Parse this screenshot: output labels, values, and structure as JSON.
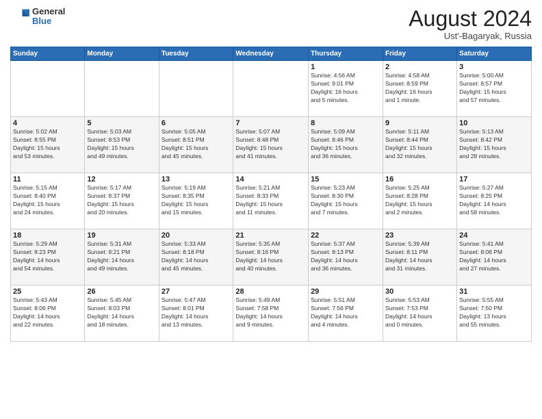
{
  "logo": {
    "general": "General",
    "blue": "Blue"
  },
  "title": "August 2024",
  "location": "Ust'-Bagaryak, Russia",
  "days_of_week": [
    "Sunday",
    "Monday",
    "Tuesday",
    "Wednesday",
    "Thursday",
    "Friday",
    "Saturday"
  ],
  "weeks": [
    [
      {
        "day": "",
        "info": ""
      },
      {
        "day": "",
        "info": ""
      },
      {
        "day": "",
        "info": ""
      },
      {
        "day": "",
        "info": ""
      },
      {
        "day": "1",
        "info": "Sunrise: 4:56 AM\nSunset: 9:01 PM\nDaylight: 16 hours\nand 5 minutes."
      },
      {
        "day": "2",
        "info": "Sunrise: 4:58 AM\nSunset: 8:59 PM\nDaylight: 16 hours\nand 1 minute."
      },
      {
        "day": "3",
        "info": "Sunrise: 5:00 AM\nSunset: 8:57 PM\nDaylight: 15 hours\nand 57 minutes."
      }
    ],
    [
      {
        "day": "4",
        "info": "Sunrise: 5:02 AM\nSunset: 8:55 PM\nDaylight: 15 hours\nand 53 minutes."
      },
      {
        "day": "5",
        "info": "Sunrise: 5:03 AM\nSunset: 8:53 PM\nDaylight: 15 hours\nand 49 minutes."
      },
      {
        "day": "6",
        "info": "Sunrise: 5:05 AM\nSunset: 8:51 PM\nDaylight: 15 hours\nand 45 minutes."
      },
      {
        "day": "7",
        "info": "Sunrise: 5:07 AM\nSunset: 8:48 PM\nDaylight: 15 hours\nand 41 minutes."
      },
      {
        "day": "8",
        "info": "Sunrise: 5:09 AM\nSunset: 8:46 PM\nDaylight: 15 hours\nand 36 minutes."
      },
      {
        "day": "9",
        "info": "Sunrise: 5:11 AM\nSunset: 8:44 PM\nDaylight: 15 hours\nand 32 minutes."
      },
      {
        "day": "10",
        "info": "Sunrise: 5:13 AM\nSunset: 8:42 PM\nDaylight: 15 hours\nand 28 minutes."
      }
    ],
    [
      {
        "day": "11",
        "info": "Sunrise: 5:15 AM\nSunset: 8:40 PM\nDaylight: 15 hours\nand 24 minutes."
      },
      {
        "day": "12",
        "info": "Sunrise: 5:17 AM\nSunset: 8:37 PM\nDaylight: 15 hours\nand 20 minutes."
      },
      {
        "day": "13",
        "info": "Sunrise: 5:19 AM\nSunset: 8:35 PM\nDaylight: 15 hours\nand 15 minutes."
      },
      {
        "day": "14",
        "info": "Sunrise: 5:21 AM\nSunset: 8:33 PM\nDaylight: 15 hours\nand 11 minutes."
      },
      {
        "day": "15",
        "info": "Sunrise: 5:23 AM\nSunset: 8:30 PM\nDaylight: 15 hours\nand 7 minutes."
      },
      {
        "day": "16",
        "info": "Sunrise: 5:25 AM\nSunset: 8:28 PM\nDaylight: 15 hours\nand 2 minutes."
      },
      {
        "day": "17",
        "info": "Sunrise: 5:27 AM\nSunset: 8:25 PM\nDaylight: 14 hours\nand 58 minutes."
      }
    ],
    [
      {
        "day": "18",
        "info": "Sunrise: 5:29 AM\nSunset: 8:23 PM\nDaylight: 14 hours\nand 54 minutes."
      },
      {
        "day": "19",
        "info": "Sunrise: 5:31 AM\nSunset: 8:21 PM\nDaylight: 14 hours\nand 49 minutes."
      },
      {
        "day": "20",
        "info": "Sunrise: 5:33 AM\nSunset: 8:18 PM\nDaylight: 14 hours\nand 45 minutes."
      },
      {
        "day": "21",
        "info": "Sunrise: 5:35 AM\nSunset: 8:16 PM\nDaylight: 14 hours\nand 40 minutes."
      },
      {
        "day": "22",
        "info": "Sunrise: 5:37 AM\nSunset: 8:13 PM\nDaylight: 14 hours\nand 36 minutes."
      },
      {
        "day": "23",
        "info": "Sunrise: 5:39 AM\nSunset: 8:11 PM\nDaylight: 14 hours\nand 31 minutes."
      },
      {
        "day": "24",
        "info": "Sunrise: 5:41 AM\nSunset: 8:08 PM\nDaylight: 14 hours\nand 27 minutes."
      }
    ],
    [
      {
        "day": "25",
        "info": "Sunrise: 5:43 AM\nSunset: 8:06 PM\nDaylight: 14 hours\nand 22 minutes."
      },
      {
        "day": "26",
        "info": "Sunrise: 5:45 AM\nSunset: 8:03 PM\nDaylight: 14 hours\nand 18 minutes."
      },
      {
        "day": "27",
        "info": "Sunrise: 5:47 AM\nSunset: 8:01 PM\nDaylight: 14 hours\nand 13 minutes."
      },
      {
        "day": "28",
        "info": "Sunrise: 5:49 AM\nSunset: 7:58 PM\nDaylight: 14 hours\nand 9 minutes."
      },
      {
        "day": "29",
        "info": "Sunrise: 5:51 AM\nSunset: 7:56 PM\nDaylight: 14 hours\nand 4 minutes."
      },
      {
        "day": "30",
        "info": "Sunrise: 5:53 AM\nSunset: 7:53 PM\nDaylight: 14 hours\nand 0 minutes."
      },
      {
        "day": "31",
        "info": "Sunrise: 5:55 AM\nSunset: 7:50 PM\nDaylight: 13 hours\nand 55 minutes."
      }
    ]
  ]
}
